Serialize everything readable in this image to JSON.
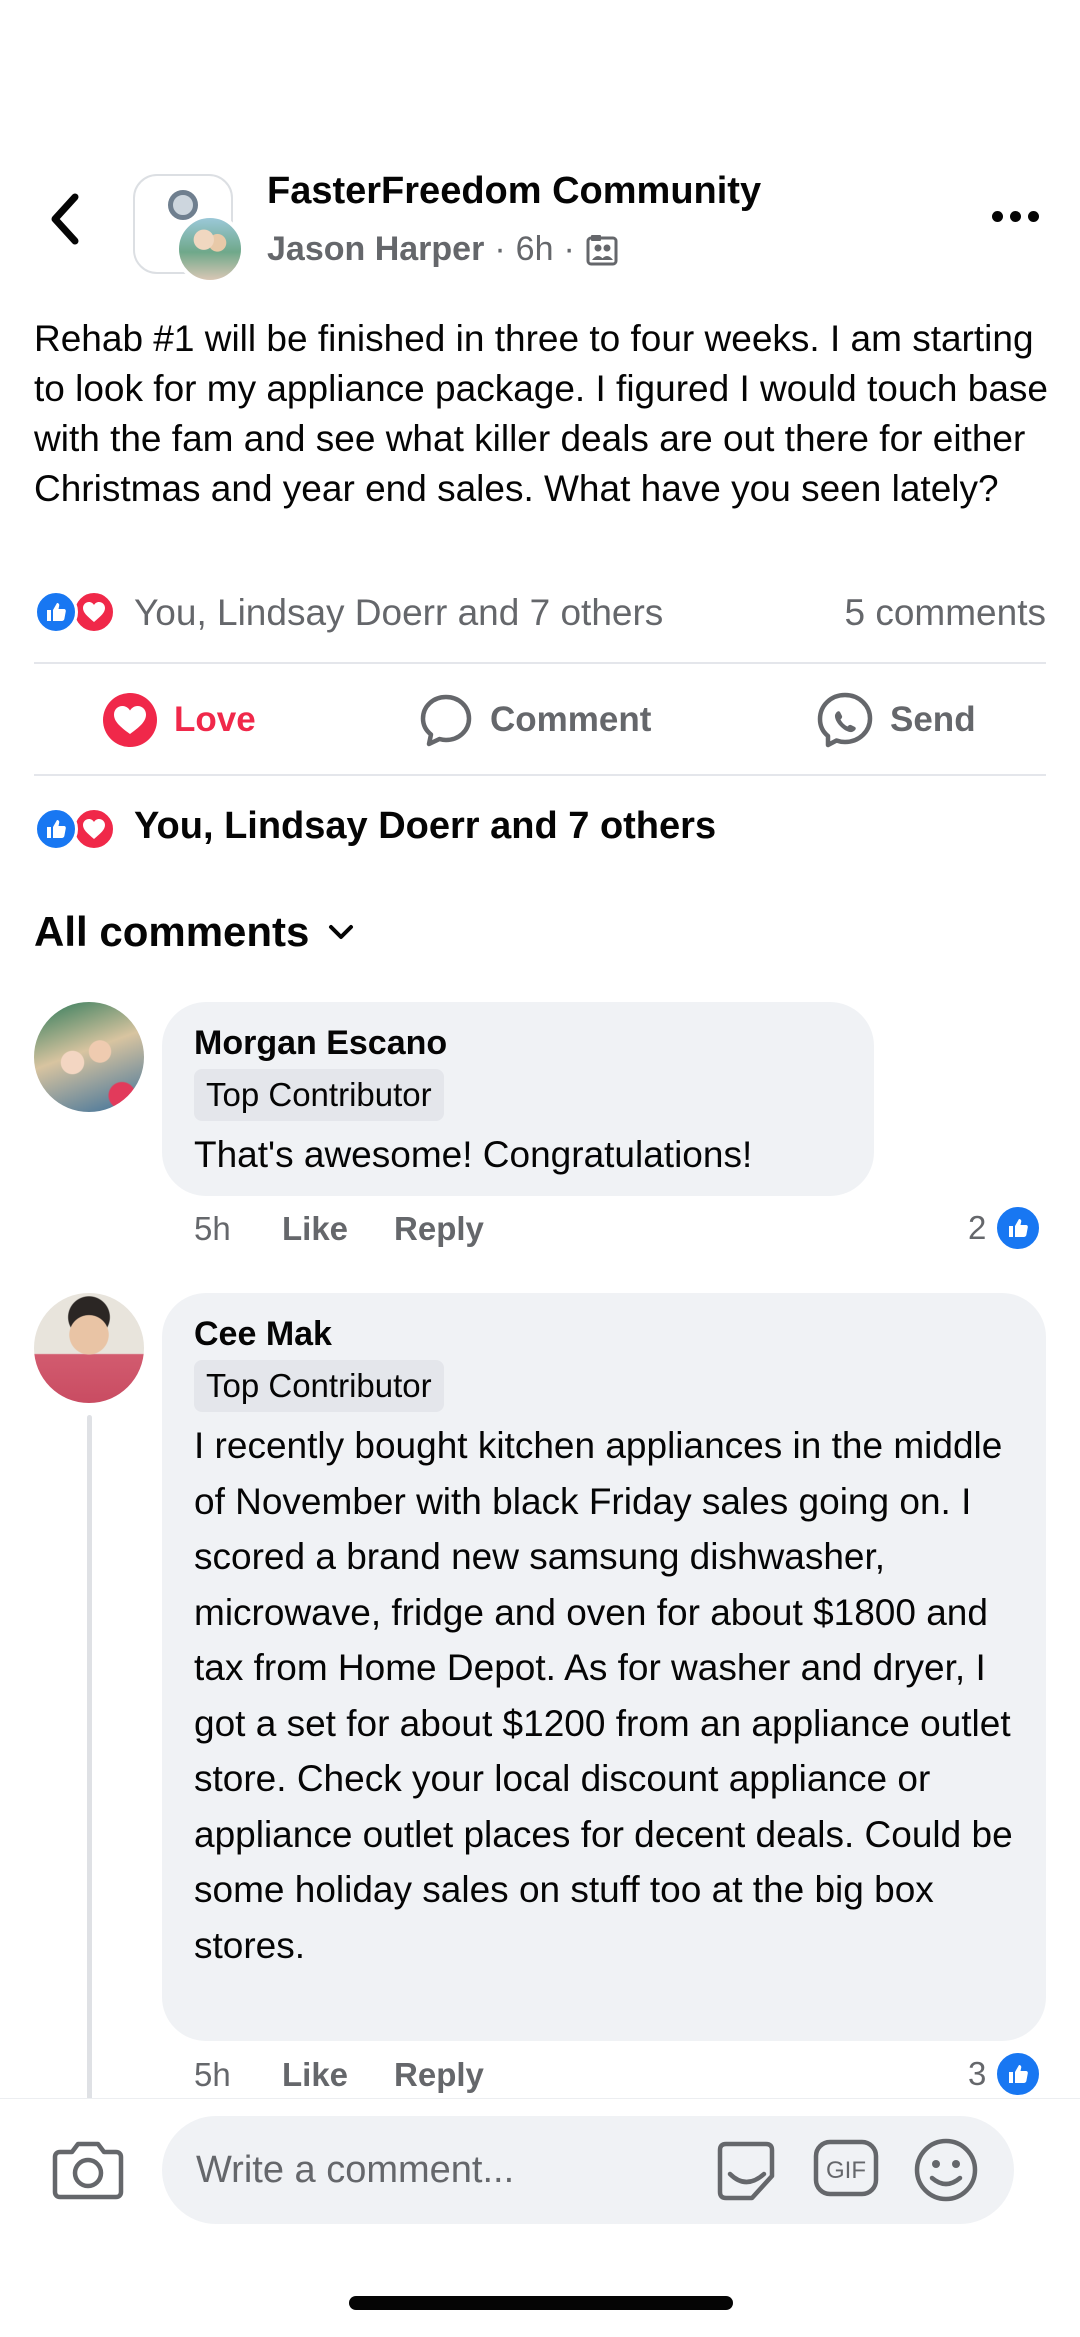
{
  "header": {
    "group_name": "FasterFreedom Community",
    "author": "Jason Harper",
    "time": "6h",
    "separator": "·"
  },
  "post": {
    "text": "Rehab #1 will be finished in three to four weeks. I am starting to look for my appliance package. I figured I would touch base with the fam and see what killer deals are out there for either Christmas and year end sales. What have you seen lately?",
    "reactions_text": "You, Lindsay Doerr and 7 others",
    "comment_count": "5 comments"
  },
  "actions": {
    "love_label": "Love",
    "comment_label": "Comment",
    "send_label": "Send"
  },
  "reactions_full": "You, Lindsay Doerr and 7 others",
  "all_comments_label": "All comments",
  "comments": [
    {
      "author": "Morgan Escano",
      "badge": "Top Contributor",
      "text": "That's awesome! Congratulations!",
      "time": "5h",
      "like_label": "Like",
      "reply_label": "Reply",
      "like_count": "2"
    },
    {
      "author": "Cee Mak",
      "badge": "Top Contributor",
      "text": "I recently bought kitchen appliances in the middle of November with black Friday sales going on. I scored a brand new samsung dishwasher, microwave, fridge and oven for about $1800 and tax from Home Depot. As for washer and dryer, I got a set for about $1200 from an appliance outlet store. Check your local discount appliance or appliance outlet places for decent deals. Could be some holiday sales on stuff too at the big box stores.",
      "time": "5h",
      "like_label": "Like",
      "reply_label": "Reply",
      "like_count": "3"
    }
  ],
  "composer": {
    "placeholder": "Write a comment...",
    "gif_label": "GIF"
  },
  "icons": {
    "back": "chevron-left-icon",
    "more": "more-dots-icon",
    "audience": "group-audience-icon",
    "like": "like-reaction-icon",
    "love": "love-reaction-icon",
    "comment": "comment-icon",
    "send": "messenger-send-icon",
    "camera": "camera-icon",
    "sticker": "sticker-icon",
    "gif": "gif-icon",
    "emoji": "emoji-icon"
  },
  "colors": {
    "accent_blue": "#1877f2",
    "love_red": "#f0284a",
    "secondary_text": "#65676b",
    "bubble_bg": "#f0f2f5"
  }
}
